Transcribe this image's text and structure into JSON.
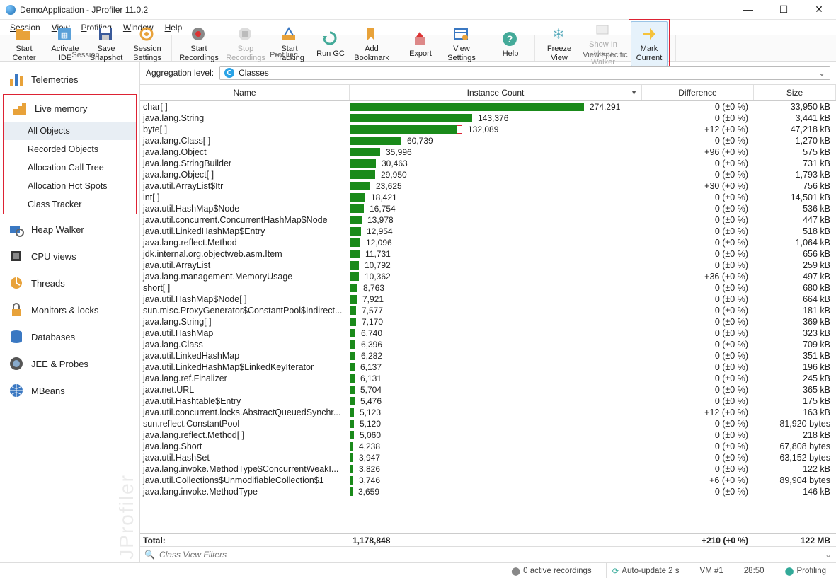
{
  "window": {
    "title": "DemoApplication - JProfiler 11.0.2"
  },
  "menu": {
    "items": [
      "Session",
      "View",
      "Profiling",
      "Window",
      "Help"
    ]
  },
  "toolbar": {
    "groups": [
      {
        "label": "Session",
        "buttons": [
          {
            "id": "start-center",
            "l1": "Start",
            "l2": "Center",
            "icon": "folder"
          },
          {
            "id": "activate-ide",
            "l1": "Activate",
            "l2": "IDE",
            "icon": "ide"
          },
          {
            "id": "save-snapshot",
            "l1": "Save",
            "l2": "Snapshot",
            "icon": "save"
          },
          {
            "id": "session-settings",
            "l1": "Session",
            "l2": "Settings",
            "icon": "gear"
          }
        ]
      },
      {
        "label": "Profiling",
        "buttons": [
          {
            "id": "start-recordings",
            "l1": "Start",
            "l2": "Recordings",
            "icon": "rec"
          },
          {
            "id": "stop-recordings",
            "l1": "Stop",
            "l2": "Recordings",
            "icon": "stop",
            "disabled": true
          },
          {
            "id": "start-tracking",
            "l1": "Start",
            "l2": "Tracking",
            "icon": "track"
          },
          {
            "id": "run-gc",
            "l1": "Run GC",
            "l2": "",
            "icon": "gc"
          },
          {
            "id": "add-bookmark",
            "l1": "Add",
            "l2": "Bookmark",
            "icon": "bookmark"
          }
        ]
      },
      {
        "label": "",
        "buttons": [
          {
            "id": "export",
            "l1": "Export",
            "l2": "",
            "icon": "export"
          },
          {
            "id": "view-settings",
            "l1": "View",
            "l2": "Settings",
            "icon": "vsettings"
          }
        ]
      },
      {
        "label": "",
        "buttons": [
          {
            "id": "help",
            "l1": "Help",
            "l2": "",
            "icon": "help"
          }
        ]
      },
      {
        "label": "View specific",
        "buttons": [
          {
            "id": "freeze-view",
            "l1": "Freeze",
            "l2": "View",
            "icon": "freeze"
          },
          {
            "id": "show-in-heap",
            "l1": "Show In",
            "l2": "Heap Walker",
            "icon": "heap",
            "disabled": true
          },
          {
            "id": "mark-current",
            "l1": "Mark",
            "l2": "Current",
            "icon": "mark",
            "highlight": true
          }
        ]
      }
    ]
  },
  "sidebar": {
    "cats": [
      {
        "id": "telemetries",
        "label": "Telemetries",
        "icon": "telemetry"
      },
      {
        "id": "live-memory",
        "label": "Live memory",
        "icon": "livemem",
        "subs": [
          {
            "id": "all-objects",
            "label": "All Objects",
            "active": true
          },
          {
            "id": "recorded-objects",
            "label": "Recorded Objects"
          },
          {
            "id": "alloc-call-tree",
            "label": "Allocation Call Tree"
          },
          {
            "id": "alloc-hot-spots",
            "label": "Allocation Hot Spots"
          },
          {
            "id": "class-tracker",
            "label": "Class Tracker"
          }
        ]
      },
      {
        "id": "heap-walker",
        "label": "Heap Walker",
        "icon": "heapwalker"
      },
      {
        "id": "cpu-views",
        "label": "CPU views",
        "icon": "cpu"
      },
      {
        "id": "threads",
        "label": "Threads",
        "icon": "threads"
      },
      {
        "id": "monitors",
        "label": "Monitors & locks",
        "icon": "lock"
      },
      {
        "id": "databases",
        "label": "Databases",
        "icon": "db"
      },
      {
        "id": "jee-probes",
        "label": "JEE & Probes",
        "icon": "probe"
      },
      {
        "id": "mbeans",
        "label": "MBeans",
        "icon": "globe"
      }
    ],
    "watermark": "JProfiler"
  },
  "agg": {
    "label": "Aggregation level:",
    "value": "Classes"
  },
  "columns": {
    "name": "Name",
    "instance": "Instance Count",
    "diff": "Difference",
    "size": "Size"
  },
  "max_count": 274291,
  "rows": [
    {
      "name": "char[ ]",
      "count": 274291,
      "count_s": "274,291",
      "diff": "0 (±0 %)",
      "size": "33,950 kB"
    },
    {
      "name": "java.lang.String",
      "count": 143376,
      "count_s": "143,376",
      "diff": "0 (±0 %)",
      "size": "3,441 kB"
    },
    {
      "name": "byte[ ]",
      "count": 132089,
      "count_s": "132,089",
      "diff": "+12 (+0 %)",
      "size": "47,218 kB",
      "mark": true
    },
    {
      "name": "java.lang.Class[ ]",
      "count": 60739,
      "count_s": "60,739",
      "diff": "0 (±0 %)",
      "size": "1,270 kB"
    },
    {
      "name": "java.lang.Object",
      "count": 35996,
      "count_s": "35,996",
      "diff": "+96 (+0 %)",
      "size": "575 kB"
    },
    {
      "name": "java.lang.StringBuilder",
      "count": 30463,
      "count_s": "30,463",
      "diff": "0 (±0 %)",
      "size": "731 kB"
    },
    {
      "name": "java.lang.Object[ ]",
      "count": 29950,
      "count_s": "29,950",
      "diff": "0 (±0 %)",
      "size": "1,793 kB"
    },
    {
      "name": "java.util.ArrayList$Itr",
      "count": 23625,
      "count_s": "23,625",
      "diff": "+30 (+0 %)",
      "size": "756 kB"
    },
    {
      "name": "int[ ]",
      "count": 18421,
      "count_s": "18,421",
      "diff": "0 (±0 %)",
      "size": "14,501 kB"
    },
    {
      "name": "java.util.HashMap$Node",
      "count": 16754,
      "count_s": "16,754",
      "diff": "0 (±0 %)",
      "size": "536 kB"
    },
    {
      "name": "java.util.concurrent.ConcurrentHashMap$Node",
      "count": 13978,
      "count_s": "13,978",
      "diff": "0 (±0 %)",
      "size": "447 kB"
    },
    {
      "name": "java.util.LinkedHashMap$Entry",
      "count": 12954,
      "count_s": "12,954",
      "diff": "0 (±0 %)",
      "size": "518 kB"
    },
    {
      "name": "java.lang.reflect.Method",
      "count": 12096,
      "count_s": "12,096",
      "diff": "0 (±0 %)",
      "size": "1,064 kB"
    },
    {
      "name": "jdk.internal.org.objectweb.asm.Item",
      "count": 11731,
      "count_s": "11,731",
      "diff": "0 (±0 %)",
      "size": "656 kB"
    },
    {
      "name": "java.util.ArrayList",
      "count": 10792,
      "count_s": "10,792",
      "diff": "0 (±0 %)",
      "size": "259 kB"
    },
    {
      "name": "java.lang.management.MemoryUsage",
      "count": 10362,
      "count_s": "10,362",
      "diff": "+36 (+0 %)",
      "size": "497 kB"
    },
    {
      "name": "short[ ]",
      "count": 8763,
      "count_s": "8,763",
      "diff": "0 (±0 %)",
      "size": "680 kB"
    },
    {
      "name": "java.util.HashMap$Node[ ]",
      "count": 7921,
      "count_s": "7,921",
      "diff": "0 (±0 %)",
      "size": "664 kB"
    },
    {
      "name": "sun.misc.ProxyGenerator$ConstantPool$Indirect...",
      "count": 7577,
      "count_s": "7,577",
      "diff": "0 (±0 %)",
      "size": "181 kB"
    },
    {
      "name": "java.lang.String[ ]",
      "count": 7170,
      "count_s": "7,170",
      "diff": "0 (±0 %)",
      "size": "369 kB"
    },
    {
      "name": "java.util.HashMap",
      "count": 6740,
      "count_s": "6,740",
      "diff": "0 (±0 %)",
      "size": "323 kB"
    },
    {
      "name": "java.lang.Class",
      "count": 6396,
      "count_s": "6,396",
      "diff": "0 (±0 %)",
      "size": "709 kB"
    },
    {
      "name": "java.util.LinkedHashMap",
      "count": 6282,
      "count_s": "6,282",
      "diff": "0 (±0 %)",
      "size": "351 kB"
    },
    {
      "name": "java.util.LinkedHashMap$LinkedKeyIterator",
      "count": 6137,
      "count_s": "6,137",
      "diff": "0 (±0 %)",
      "size": "196 kB"
    },
    {
      "name": "java.lang.ref.Finalizer",
      "count": 6131,
      "count_s": "6,131",
      "diff": "0 (±0 %)",
      "size": "245 kB"
    },
    {
      "name": "java.net.URL",
      "count": 5704,
      "count_s": "5,704",
      "diff": "0 (±0 %)",
      "size": "365 kB"
    },
    {
      "name": "java.util.Hashtable$Entry",
      "count": 5476,
      "count_s": "5,476",
      "diff": "0 (±0 %)",
      "size": "175 kB"
    },
    {
      "name": "java.util.concurrent.locks.AbstractQueuedSynchr...",
      "count": 5123,
      "count_s": "5,123",
      "diff": "+12 (+0 %)",
      "size": "163 kB"
    },
    {
      "name": "sun.reflect.ConstantPool",
      "count": 5120,
      "count_s": "5,120",
      "diff": "0 (±0 %)",
      "size": "81,920 bytes"
    },
    {
      "name": "java.lang.reflect.Method[ ]",
      "count": 5060,
      "count_s": "5,060",
      "diff": "0 (±0 %)",
      "size": "218 kB"
    },
    {
      "name": "java.lang.Short",
      "count": 4238,
      "count_s": "4,238",
      "diff": "0 (±0 %)",
      "size": "67,808 bytes"
    },
    {
      "name": "java.util.HashSet",
      "count": 3947,
      "count_s": "3,947",
      "diff": "0 (±0 %)",
      "size": "63,152 bytes"
    },
    {
      "name": "java.lang.invoke.MethodType$ConcurrentWeakI...",
      "count": 3826,
      "count_s": "3,826",
      "diff": "0 (±0 %)",
      "size": "122 kB"
    },
    {
      "name": "java.util.Collections$UnmodifiableCollection$1",
      "count": 3746,
      "count_s": "3,746",
      "diff": "+6 (+0 %)",
      "size": "89,904 bytes"
    },
    {
      "name": "java.lang.invoke.MethodType",
      "count": 3659,
      "count_s": "3,659",
      "diff": "0 (±0 %)",
      "size": "146 kB"
    }
  ],
  "total": {
    "label": "Total:",
    "count": "1,178,848",
    "diff": "+210 (+0 %)",
    "size": "122 MB"
  },
  "filter": {
    "placeholder": "Class View Filters"
  },
  "status": {
    "recordings": "0 active recordings",
    "auto": "Auto-update 2 s",
    "vm": "VM #1",
    "time": "28:50",
    "profiling": "Profiling"
  }
}
